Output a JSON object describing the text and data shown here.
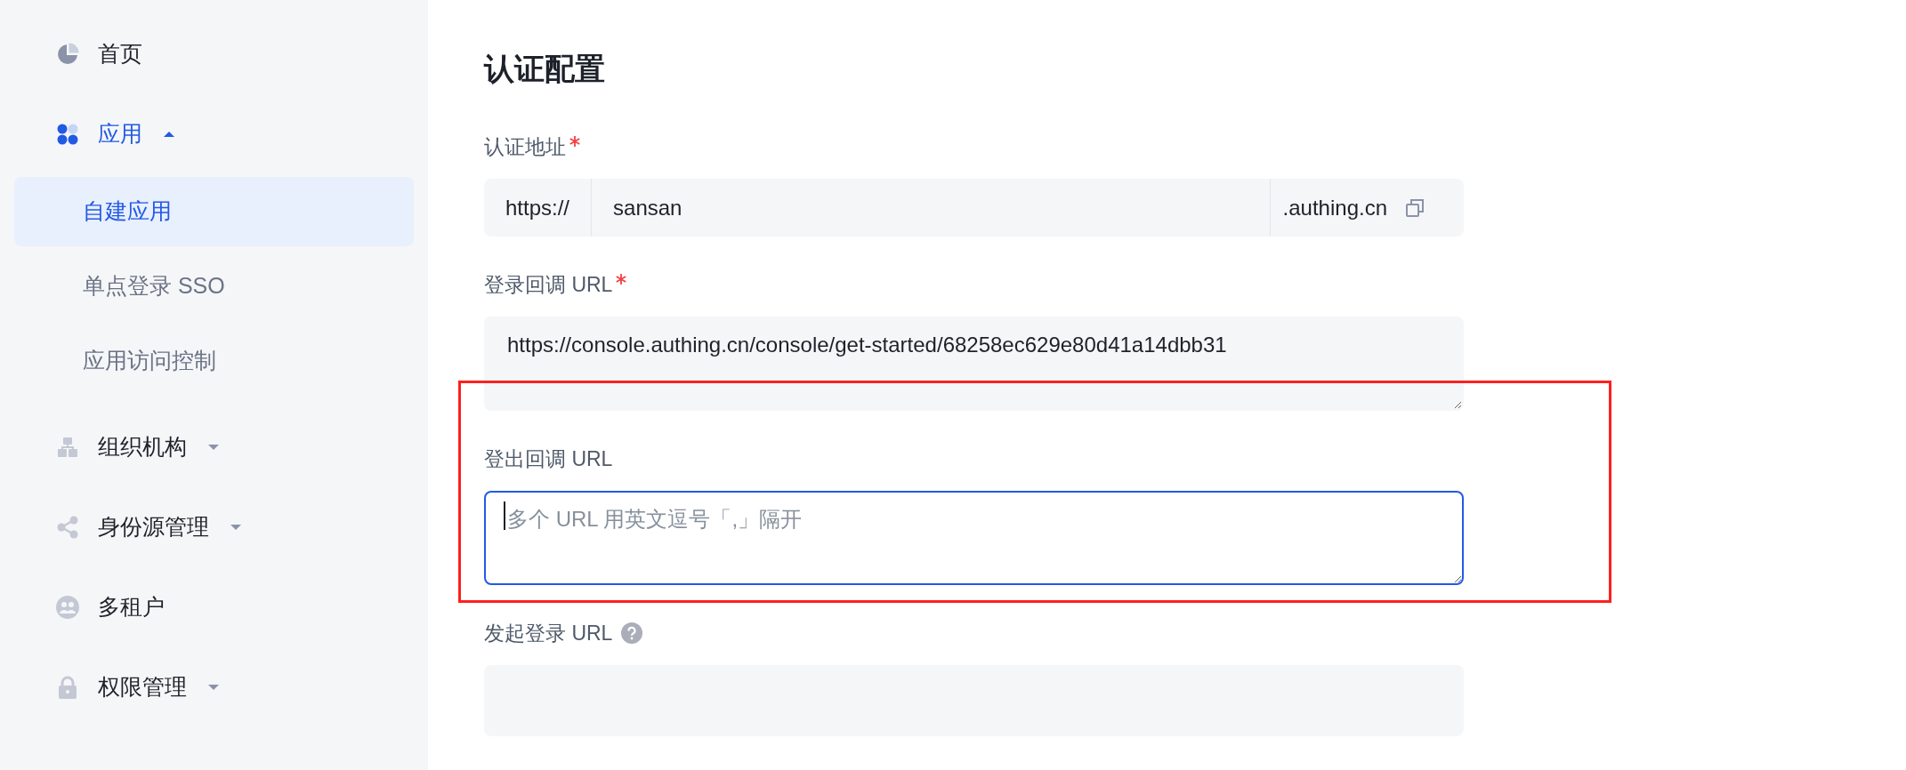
{
  "sidebar": {
    "items": [
      {
        "label": "首页",
        "selected": false
      },
      {
        "label": "应用",
        "selected": true,
        "expanded": true,
        "children": [
          {
            "label": "自建应用",
            "selected": true
          },
          {
            "label": "单点登录 SSO",
            "selected": false
          },
          {
            "label": "应用访问控制",
            "selected": false
          }
        ]
      },
      {
        "label": "组织机构",
        "selected": false,
        "expanded": false
      },
      {
        "label": "身份源管理",
        "selected": false,
        "expanded": false
      },
      {
        "label": "多租户",
        "selected": false
      },
      {
        "label": "权限管理",
        "selected": false,
        "expanded": false
      }
    ]
  },
  "form": {
    "title": "认证配置",
    "fields": [
      {
        "kind": "addon",
        "label": "认证地址",
        "required": true,
        "prefix": "https://",
        "value": "sansan",
        "suffix": ".authing.cn"
      },
      {
        "kind": "textarea",
        "label": "登录回调 URL",
        "required": true,
        "value": "https://console.authing.cn/console/get-started/68258ec629e80d41a14dbb31",
        "focused": false,
        "highlighted": false
      },
      {
        "kind": "textarea",
        "label": "登出回调 URL",
        "required": false,
        "placeholder": "多个 URL 用英文逗号「,」隔开",
        "focused": true,
        "highlighted": true
      },
      {
        "kind": "blank",
        "label": "发起登录 URL",
        "required": false,
        "help": true
      }
    ]
  }
}
